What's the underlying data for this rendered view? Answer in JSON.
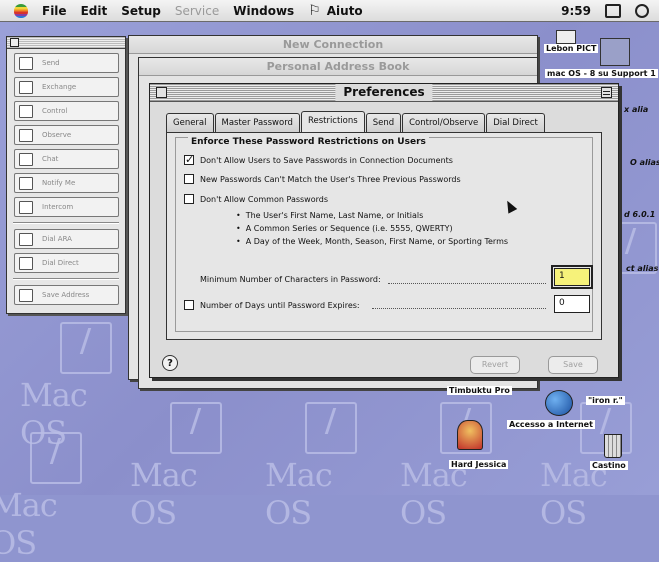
{
  "menubar": {
    "items": [
      "File",
      "Edit",
      "Setup",
      "Service",
      "Windows",
      "Aiuto"
    ],
    "disabled": [
      "Service"
    ],
    "clock": "9:59"
  },
  "palette": {
    "buttons": [
      "Send",
      "Exchange",
      "Control",
      "Observe",
      "Chat",
      "Notify Me",
      "Intercom",
      "Dial ARA",
      "Dial Direct",
      "Save Address"
    ]
  },
  "windows": {
    "new_connection": "New Connection",
    "address_book": "Personal Address Book",
    "preferences": "Preferences"
  },
  "tabs": [
    "General",
    "Master Password",
    "Restrictions",
    "Send",
    "Control/Observe",
    "Dial Direct"
  ],
  "active_tab": "Restrictions",
  "restrictions": {
    "group_title": "Enforce These Password Restrictions on Users",
    "options": [
      {
        "label": "Don't Allow Users to Save Passwords in Connection Documents",
        "checked": true
      },
      {
        "label": "New Passwords Can't Match the User's Three Previous Passwords",
        "checked": false
      },
      {
        "label": "Don't Allow Common Passwords",
        "checked": false
      }
    ],
    "common_list": [
      "The User's First Name, Last Name, or Initials",
      "A Common Series or Sequence (i.e. 5555, QWERTY)",
      "A Day of the Week, Month, Season, First Name, or Sporting Terms"
    ],
    "min_chars_label": "Minimum Number of Characters in Password:",
    "min_chars_value": "1",
    "expire_label": "Number of Days until Password Expires:",
    "expire_checked": false,
    "expire_value": "0"
  },
  "buttons": {
    "help": "?",
    "revert": "Revert",
    "save": "Save"
  },
  "desktop": {
    "icons": [
      {
        "label": "Timbuktu Pro"
      },
      {
        "label": "\"iron r.\""
      },
      {
        "label": "Accesso a Internet"
      },
      {
        "label": "Hard Jessica"
      },
      {
        "label": "Castino"
      }
    ],
    "edge_labels": [
      "Lebon PICT",
      "mac OS - 8 su Support 1",
      "x alia",
      "O alias",
      "d 6.0.1",
      "ct alias"
    ],
    "pattern_word": "Mac OS"
  },
  "colors": {
    "desktop": "#8f95cf",
    "focus_field": "#f6f27a"
  }
}
